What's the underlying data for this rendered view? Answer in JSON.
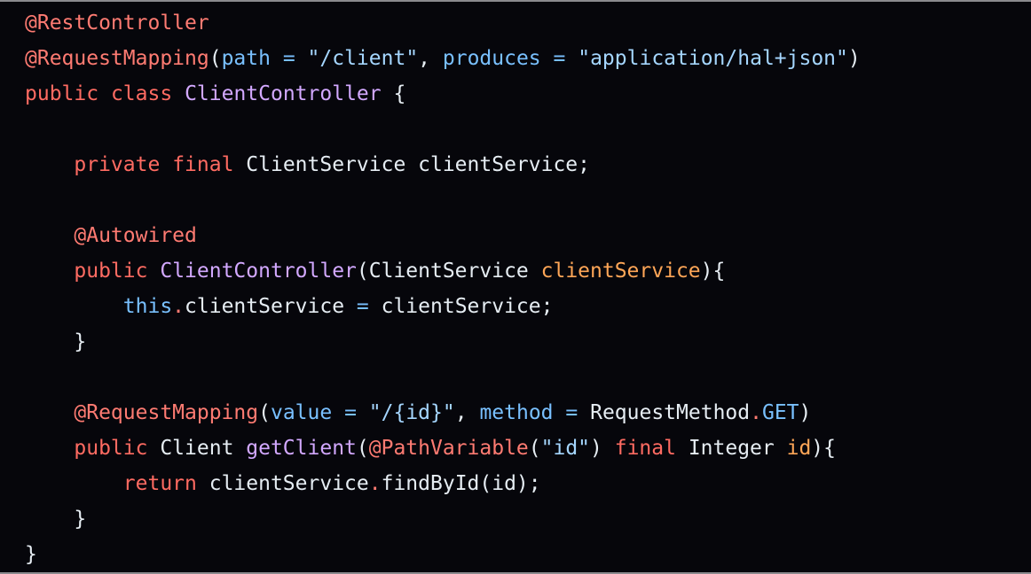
{
  "editor": {
    "language": "java",
    "colors": {
      "background": "#06060b",
      "keyword": "#ff6b62",
      "annotation": "#ff7b72",
      "class_name": "#d2a8ff",
      "string": "#a5d6ff",
      "param_name": "#79c0ff",
      "argument": "#ffa657",
      "default_text": "#e6edf3"
    },
    "lines": [
      [
        {
          "t": "ann",
          "v": "@RestController"
        }
      ],
      [
        {
          "t": "ann",
          "v": "@RequestMapping"
        },
        {
          "t": "txt",
          "v": "("
        },
        {
          "t": "prm",
          "v": "path"
        },
        {
          "t": "txt",
          "v": " "
        },
        {
          "t": "prm",
          "v": "="
        },
        {
          "t": "txt",
          "v": " "
        },
        {
          "t": "str",
          "v": "\"/client\""
        },
        {
          "t": "txt",
          "v": ", "
        },
        {
          "t": "prm",
          "v": "produces"
        },
        {
          "t": "txt",
          "v": " "
        },
        {
          "t": "prm",
          "v": "="
        },
        {
          "t": "txt",
          "v": " "
        },
        {
          "t": "str",
          "v": "\"application/hal+json\""
        },
        {
          "t": "txt",
          "v": ")"
        }
      ],
      [
        {
          "t": "kw",
          "v": "public"
        },
        {
          "t": "txt",
          "v": " "
        },
        {
          "t": "kw",
          "v": "class"
        },
        {
          "t": "txt",
          "v": " "
        },
        {
          "t": "cls",
          "v": "ClientController"
        },
        {
          "t": "txt",
          "v": " {"
        }
      ],
      [],
      [
        {
          "t": "txt",
          "v": "    "
        },
        {
          "t": "kw",
          "v": "private"
        },
        {
          "t": "txt",
          "v": " "
        },
        {
          "t": "kw",
          "v": "final"
        },
        {
          "t": "txt",
          "v": " ClientService clientService;"
        }
      ],
      [],
      [
        {
          "t": "txt",
          "v": "    "
        },
        {
          "t": "ann",
          "v": "@Autowired"
        }
      ],
      [
        {
          "t": "txt",
          "v": "    "
        },
        {
          "t": "kw",
          "v": "public"
        },
        {
          "t": "txt",
          "v": " "
        },
        {
          "t": "fn",
          "v": "ClientController"
        },
        {
          "t": "txt",
          "v": "(ClientService "
        },
        {
          "t": "arg",
          "v": "clientService"
        },
        {
          "t": "txt",
          "v": "){"
        }
      ],
      [
        {
          "t": "txt",
          "v": "        "
        },
        {
          "t": "prm",
          "v": "this"
        },
        {
          "t": "dot",
          "v": "."
        },
        {
          "t": "txt",
          "v": "clientService "
        },
        {
          "t": "prm",
          "v": "="
        },
        {
          "t": "txt",
          "v": " clientService;"
        }
      ],
      [
        {
          "t": "txt",
          "v": "    }"
        }
      ],
      [],
      [
        {
          "t": "txt",
          "v": "    "
        },
        {
          "t": "ann",
          "v": "@RequestMapping"
        },
        {
          "t": "txt",
          "v": "("
        },
        {
          "t": "prm",
          "v": "value"
        },
        {
          "t": "txt",
          "v": " "
        },
        {
          "t": "prm",
          "v": "="
        },
        {
          "t": "txt",
          "v": " "
        },
        {
          "t": "str",
          "v": "\"/{id}\""
        },
        {
          "t": "txt",
          "v": ", "
        },
        {
          "t": "prm",
          "v": "method"
        },
        {
          "t": "txt",
          "v": " "
        },
        {
          "t": "prm",
          "v": "="
        },
        {
          "t": "txt",
          "v": " RequestMethod"
        },
        {
          "t": "dot",
          "v": "."
        },
        {
          "t": "prm",
          "v": "GET"
        },
        {
          "t": "txt",
          "v": ")"
        }
      ],
      [
        {
          "t": "txt",
          "v": "    "
        },
        {
          "t": "kw",
          "v": "public"
        },
        {
          "t": "txt",
          "v": " Client "
        },
        {
          "t": "fn",
          "v": "getClient"
        },
        {
          "t": "txt",
          "v": "("
        },
        {
          "t": "ann",
          "v": "@PathVariable"
        },
        {
          "t": "txt",
          "v": "("
        },
        {
          "t": "str",
          "v": "\"id\""
        },
        {
          "t": "txt",
          "v": ") "
        },
        {
          "t": "kw",
          "v": "final"
        },
        {
          "t": "txt",
          "v": " Integer "
        },
        {
          "t": "arg",
          "v": "id"
        },
        {
          "t": "txt",
          "v": "){"
        }
      ],
      [
        {
          "t": "txt",
          "v": "        "
        },
        {
          "t": "kw",
          "v": "return"
        },
        {
          "t": "txt",
          "v": " clientService"
        },
        {
          "t": "dot",
          "v": "."
        },
        {
          "t": "txt",
          "v": "findById(id);"
        }
      ],
      [
        {
          "t": "txt",
          "v": "    }"
        }
      ],
      [
        {
          "t": "txt",
          "v": "}"
        }
      ]
    ]
  }
}
